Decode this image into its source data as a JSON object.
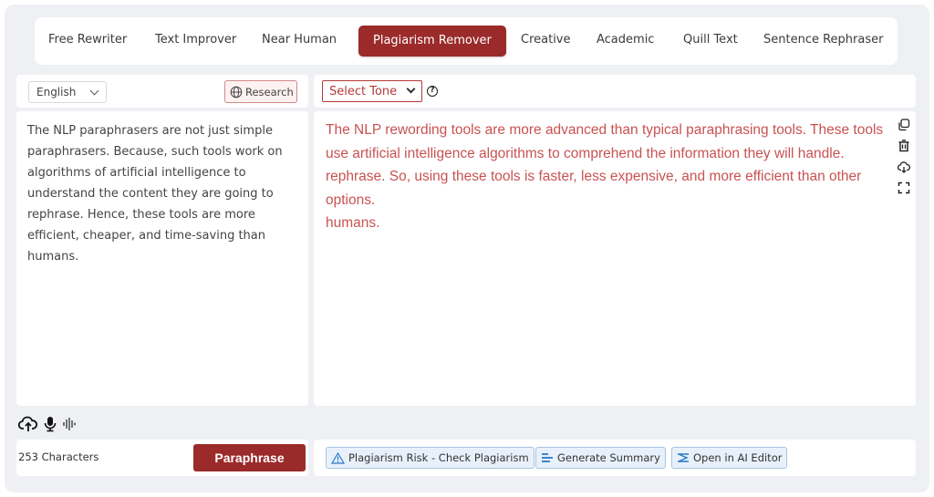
{
  "tabs": [
    {
      "label": "Free Rewriter",
      "active": false
    },
    {
      "label": "Text Improver",
      "active": false
    },
    {
      "label": "Near Human",
      "active": false
    },
    {
      "label": "Plagiarism Remover",
      "active": true
    },
    {
      "label": "Creative",
      "active": false
    },
    {
      "label": "Academic",
      "active": false
    },
    {
      "label": "Quill Text",
      "active": false
    },
    {
      "label": "Sentence Rephraser",
      "active": false
    }
  ],
  "input_panel": {
    "language": "English",
    "research_label": "Research",
    "text": "The NLP paraphrasers are not just simple\nparaphrasers. Because, such tools work on\nalgorithms of artificial intelligence to\nunderstand the content they are going to\nrephrase. Hence, these tools are more\nefficient, cheaper, and time-saving than\nhumans.",
    "char_count": "253 Characters",
    "paraphrase_label": "Paraphrase",
    "icons": [
      "upload-cloud-icon",
      "microphone-icon",
      "audio-wave-icon"
    ]
  },
  "output_panel": {
    "tone_label": "Select Tone",
    "text": "The NLP rewording tools are more advanced than typical paraphrasing tools. These tools\nuse artificial intelligence algorithms to comprehend the information they will handle.\nrephrase. So, using these tools is faster, less expensive, and more efficient than other\noptions.\nhumans.",
    "side_icons": [
      "copy-icon",
      "trash-icon",
      "download-cloud-icon",
      "fullscreen-icon"
    ],
    "actions": {
      "plagiarism": "Plagiarism Risk - Check Plagiarism",
      "summary": "Generate Summary",
      "editor": "Open in AI Editor"
    }
  },
  "colors": {
    "accent": "#9b2a2a",
    "output_text": "#c85252",
    "action_bg": "#e8f1fb",
    "background": "#eef0f4"
  }
}
